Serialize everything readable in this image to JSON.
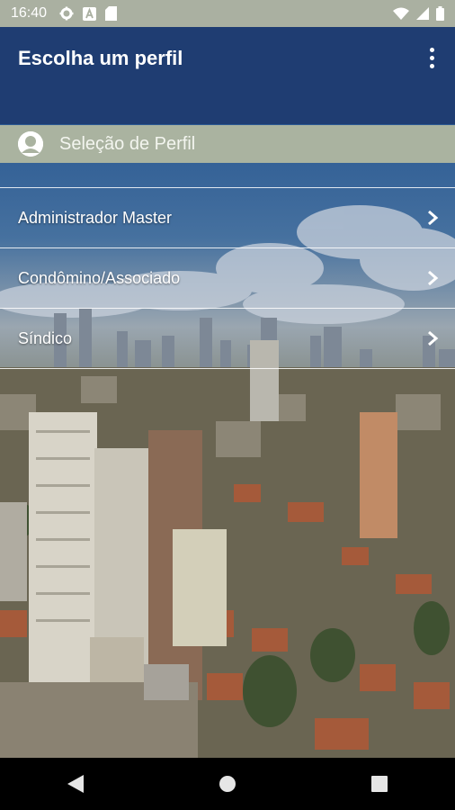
{
  "status_bar": {
    "time": "16:40",
    "left_icons": [
      "settings-icon",
      "font-icon",
      "sd-card-icon"
    ],
    "right_icons": [
      "wifi-icon",
      "signal-icon",
      "battery-icon"
    ]
  },
  "app_bar": {
    "title": "Escolha um perfil",
    "menu_icon": "more-vert-icon",
    "color": "#1f3d72"
  },
  "section": {
    "label": "Seleção de Perfil",
    "icon": "person-icon",
    "color": "#aab3a0"
  },
  "profiles": [
    {
      "label": "Administrador Master",
      "icon": "chevron-right-icon"
    },
    {
      "label": "Condômino/Associado",
      "icon": "chevron-right-icon"
    },
    {
      "label": "Síndico",
      "icon": "chevron-right-icon"
    }
  ],
  "nav_bar": {
    "buttons": [
      "back-icon",
      "home-icon",
      "recents-icon"
    ]
  }
}
